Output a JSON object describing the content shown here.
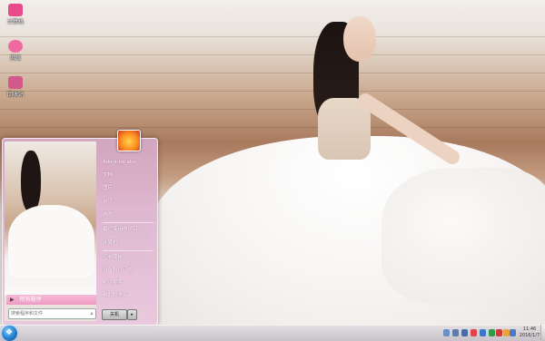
{
  "desktop": {
    "icons": [
      {
        "label": "计算机",
        "icon": "computer-icon",
        "color": "#e84b8a"
      },
      {
        "label": "网络",
        "icon": "network-icon",
        "color": "#ee6aa0"
      },
      {
        "label": "回收站",
        "icon": "recycle-bin-icon",
        "color": "#d25a8a"
      }
    ]
  },
  "start_menu": {
    "all_programs": "所有程序",
    "search_placeholder": "搜索程序和文件",
    "user_name": "Administrator",
    "right_items": [
      "Administrator",
      "文档",
      "图片",
      "音乐",
      "游戏",
      "最近使用的项目",
      "计算机",
      "控制面板",
      "设备和打印机",
      "默认程序",
      "帮助和支持"
    ],
    "shutdown_label": "关机",
    "shutdown_arrow": "▸"
  },
  "taskbar": {
    "start_glyph": "❖",
    "clock_time": "11:46",
    "clock_date": "2016/1/7",
    "tray_icons": [
      {
        "icon": "chevron-up-icon",
        "color": "#6a8fc2"
      },
      {
        "icon": "network-tray-icon",
        "color": "#5b7da8"
      },
      {
        "icon": "volume-icon",
        "color": "#4a6ea1"
      },
      {
        "icon": "flag-icon",
        "color": "#e04545"
      },
      {
        "icon": "ime-icon",
        "color": "#3c78c8"
      },
      {
        "icon": "app-tray-icon",
        "color": "#2f9b49"
      },
      {
        "icon": "security-icon",
        "color": "#d13a3a"
      },
      {
        "icon": "settings-tray-icon",
        "color": "#e8a33a"
      },
      {
        "icon": "help-tray-icon",
        "color": "#4b78c6"
      }
    ]
  },
  "colors": {
    "accent": "#ee9bc4",
    "menu_bg": "#d6aac8"
  }
}
